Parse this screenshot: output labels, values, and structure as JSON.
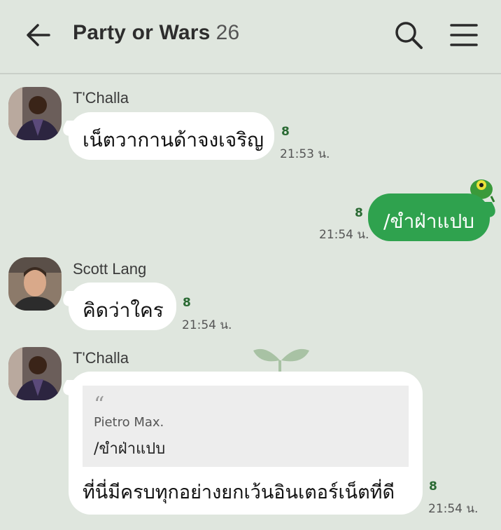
{
  "header": {
    "title": "Party or Wars",
    "member_count": "26"
  },
  "messages": [
    {
      "sender": "T'Challa",
      "text": "เน็ตวากานด้าจงเจริญ",
      "read": "8",
      "time": "21:53 น."
    },
    {
      "sender": "me",
      "text": "/ขำฝ่าแปบ",
      "read": "8",
      "time": "21:54 น."
    },
    {
      "sender": "Scott Lang",
      "text": "คิดว่าใคร",
      "read": "8",
      "time": "21:54 น."
    },
    {
      "sender": "T'Challa",
      "quote_author": "Pietro Max.",
      "quote_text": "/ขำฝ่าแปบ",
      "text": "ที่นี่มีครบทุกอย่างยกเว้นอินเตอร์เน็ตที่ดี",
      "read": "8",
      "time": "21:54 น."
    }
  ],
  "colors": {
    "background": "#dfe6de",
    "own_bubble": "#2fa24e",
    "other_bubble": "#ffffff",
    "read_indicator": "#2a6a33"
  },
  "icons": [
    "back-arrow-icon",
    "search-icon",
    "menu-icon",
    "frog-sticker-icon",
    "quote-icon"
  ]
}
